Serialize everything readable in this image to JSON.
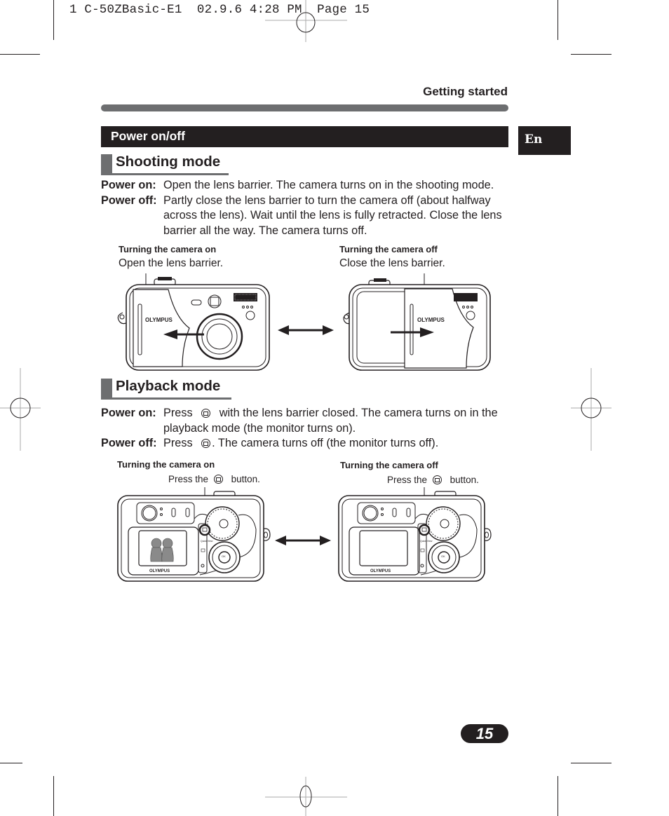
{
  "slug": "1 C-50ZBasic-E1  02.9.6 4:28 PM  Page 15",
  "header": {
    "section_label": "Getting started",
    "power_bar_title": "Power on/off",
    "language_tab": "En"
  },
  "shooting_mode": {
    "heading": "Shooting mode",
    "rows": [
      {
        "label": "Power on:",
        "text": "Open the lens barrier. The camera turns on in the shooting mode."
      },
      {
        "label": "Power off:",
        "text": "Partly close the lens barrier to turn the camera off (about halfway across the lens). Wait until the lens is fully retracted. Close the lens barrier all the way. The camera turns off."
      }
    ],
    "figure_on": {
      "title": "Turning the camera on",
      "caption": "Open the lens barrier.",
      "brand": "OLYMPUS"
    },
    "figure_off": {
      "title": "Turning the camera off",
      "caption": "Close the lens barrier.",
      "brand": "OLYMPUS"
    }
  },
  "playback_mode": {
    "heading": "Playback mode",
    "rows": [
      {
        "label": "Power on:",
        "before": "Press",
        "after": "with the lens barrier closed. The camera turns on in the playback mode (the monitor turns on).",
        "icon": "monitor-button-icon"
      },
      {
        "label": "Power off:",
        "before": "Press",
        "after": ". The camera turns off (the monitor turns off).",
        "icon": "monitor-button-icon"
      }
    ],
    "figure_on": {
      "title": "Turning the camera on",
      "caption_before": "Press the",
      "caption_after": "button.",
      "brand": "OLYMPUS",
      "quick_view": "Quick View",
      "ok": "OK"
    },
    "figure_off": {
      "title": "Turning the camera off",
      "caption_before": "Press the",
      "caption_after": "button.",
      "brand": "OLYMPUS",
      "quick_view": "Quick View",
      "ok": "OK"
    }
  },
  "footer": {
    "page_number": "15"
  }
}
